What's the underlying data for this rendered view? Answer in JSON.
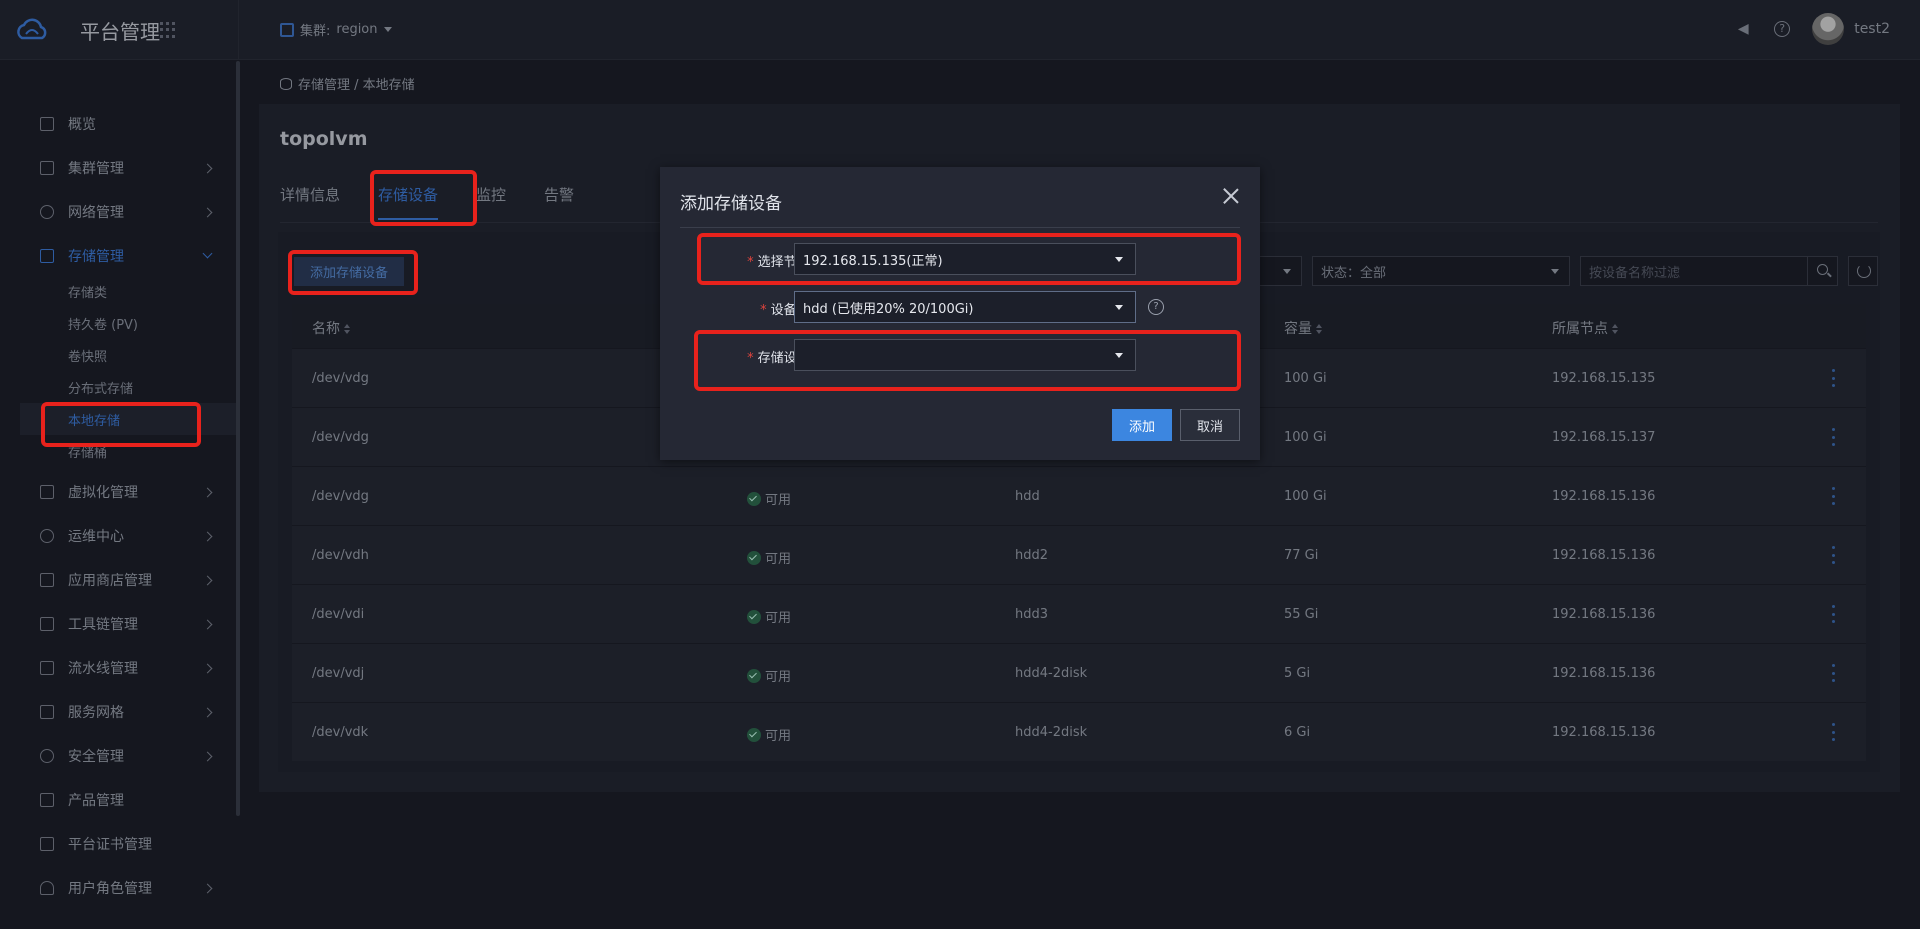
{
  "topbar": {
    "brand": "平台管理",
    "cluster_label": "集群:",
    "cluster_value": "region",
    "username": "test2"
  },
  "breadcrumb": {
    "text": "存储管理 / 本地存储"
  },
  "sidebar": {
    "items": [
      {
        "label": "概览"
      },
      {
        "label": "集群管理"
      },
      {
        "label": "网络管理"
      },
      {
        "label": "存储管理"
      },
      {
        "label": "虚拟化管理"
      },
      {
        "label": "运维中心"
      },
      {
        "label": "应用商店管理"
      },
      {
        "label": "工具链管理"
      },
      {
        "label": "流水线管理"
      },
      {
        "label": "服务网格"
      },
      {
        "label": "安全管理"
      },
      {
        "label": "产品管理"
      },
      {
        "label": "平台证书管理"
      },
      {
        "label": "用户角色管理"
      }
    ],
    "storage_sub": [
      {
        "label": "存储类"
      },
      {
        "label": "持久卷 (PV)"
      },
      {
        "label": "卷快照"
      },
      {
        "label": "分布式存储"
      },
      {
        "label": "本地存储"
      },
      {
        "label": "存储桶"
      }
    ]
  },
  "page": {
    "title": "topolvm",
    "tabs": [
      "详情信息",
      "存储设备",
      "监控",
      "告警"
    ],
    "add_button": "添加存储设备",
    "filter_status": "状态：全部",
    "search_placeholder": "按设备名称过滤"
  },
  "table": {
    "headers": [
      "名称",
      "容量",
      "所属节点"
    ],
    "rows": [
      {
        "name": "/dev/vdg",
        "status": "",
        "class": "",
        "capacity": "100 Gi",
        "node": "192.168.15.135"
      },
      {
        "name": "/dev/vdg",
        "status": "",
        "class": "",
        "capacity": "100 Gi",
        "node": "192.168.15.137"
      },
      {
        "name": "/dev/vdg",
        "status": "可用",
        "class": "hdd",
        "capacity": "100 Gi",
        "node": "192.168.15.136"
      },
      {
        "name": "/dev/vdh",
        "status": "可用",
        "class": "hdd2",
        "capacity": "77 Gi",
        "node": "192.168.15.136"
      },
      {
        "name": "/dev/vdi",
        "status": "可用",
        "class": "hdd3",
        "capacity": "55 Gi",
        "node": "192.168.15.136"
      },
      {
        "name": "/dev/vdj",
        "status": "可用",
        "class": "hdd4-2disk",
        "capacity": "5 Gi",
        "node": "192.168.15.136"
      },
      {
        "name": "/dev/vdk",
        "status": "可用",
        "class": "hdd4-2disk",
        "capacity": "6 Gi",
        "node": "192.168.15.136"
      }
    ]
  },
  "modal": {
    "title": "添加存储设备",
    "fields": [
      {
        "label": "选择节点:",
        "value": "192.168.15.135(正常)"
      },
      {
        "label": "设备类:",
        "value": "hdd (已使用20%  20/100Gi)"
      },
      {
        "label": "存储设备:",
        "value": ""
      }
    ],
    "confirm": "添加",
    "cancel": "取消"
  },
  "colors": {
    "accent": "#3c86e0",
    "annotation": "#e8221c",
    "success": "#2e6b4f"
  }
}
